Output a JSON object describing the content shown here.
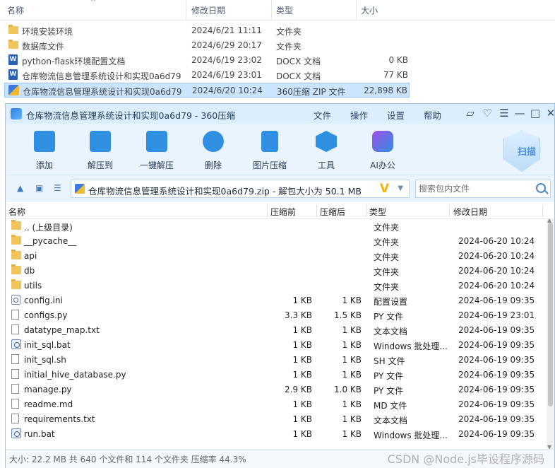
{
  "explorer": {
    "columns": {
      "name": "名称",
      "date": "修改日期",
      "type": "类型",
      "size": "大小"
    },
    "rows": [
      {
        "icon": "folder-icon",
        "name": "环境安装环境",
        "date": "2024/6/21 11:11",
        "type": "文件夹",
        "size": ""
      },
      {
        "icon": "folder-icon",
        "name": "数据库文件",
        "date": "2024/6/29 20:17",
        "type": "文件夹",
        "size": ""
      },
      {
        "icon": "word-doc-icon",
        "name": "python-flask环境配置文档",
        "date": "2024/6/19 23:02",
        "type": "DOCX 文档",
        "size": "0 KB"
      },
      {
        "icon": "word-doc-icon",
        "name": "仓库物流信息管理系统设计和实现0a6d79",
        "date": "2024/6/19 23:01",
        "type": "DOCX 文档",
        "size": "77 KB"
      },
      {
        "icon": "zip-archive-icon",
        "name": "仓库物流信息管理系统设计和实现0a6d79",
        "date": "2024/6/20 10:24",
        "type": "360压缩 ZIP 文件",
        "size": "22,898 KB",
        "selected": true
      }
    ]
  },
  "window": {
    "title": "仓库物流信息管理系统设计和实现0a6d79 - 360压缩",
    "menu": {
      "file": "文件",
      "ops": "操作",
      "settings": "设置",
      "help": "帮助"
    },
    "toolbar": {
      "add": "添加",
      "extract_to": "解压到",
      "one_click": "一键解压",
      "delete": "删除",
      "image_compress": "图片压缩",
      "tools": "工具",
      "ai_office": "AI办公",
      "scan": "扫描"
    },
    "address": "仓库物流信息管理系统设计和实现0a6d79.zip - 解包大小为 50.1 MB",
    "search_placeholder": "搜索包内文件",
    "list_columns": {
      "name": "名称",
      "compressed": "压缩前",
      "packed": "压缩后",
      "type": "类型",
      "date": "修改日期"
    },
    "files": [
      {
        "icon": "folder-icon",
        "name": ".. (上级目录)",
        "before": "",
        "after": "",
        "type": "文件夹",
        "date": ""
      },
      {
        "icon": "folder-icon",
        "name": "__pycache__",
        "before": "",
        "after": "",
        "type": "文件夹",
        "date": "2024-06-20 10:24"
      },
      {
        "icon": "folder-icon",
        "name": "api",
        "before": "",
        "after": "",
        "type": "文件夹",
        "date": "2024-06-20 10:24"
      },
      {
        "icon": "folder-icon",
        "name": "db",
        "before": "",
        "after": "",
        "type": "文件夹",
        "date": "2024-06-20 10:24"
      },
      {
        "icon": "folder-icon",
        "name": "utils",
        "before": "",
        "after": "",
        "type": "文件夹",
        "date": "2024-06-20 10:24"
      },
      {
        "icon": "config-file-icon",
        "name": "config.ini",
        "before": "1 KB",
        "after": "1 KB",
        "type": "配置设置",
        "date": "2024-06-19 09:35"
      },
      {
        "icon": "file-icon",
        "name": "configs.py",
        "before": "3.3 KB",
        "after": "1.5 KB",
        "type": "PY 文件",
        "date": "2024-06-19 23:01"
      },
      {
        "icon": "file-icon",
        "name": "datatype_map.txt",
        "before": "1 KB",
        "after": "1 KB",
        "type": "文本文档",
        "date": "2024-06-19 09:35"
      },
      {
        "icon": "batch-file-icon",
        "name": "init_sql.bat",
        "before": "1 KB",
        "after": "1 KB",
        "type": "Windows 批处理...",
        "date": "2024-06-19 09:35"
      },
      {
        "icon": "file-icon",
        "name": "init_sql.sh",
        "before": "1 KB",
        "after": "1 KB",
        "type": "SH 文件",
        "date": "2024-06-19 09:35"
      },
      {
        "icon": "file-icon",
        "name": "initial_hive_database.py",
        "before": "1 KB",
        "after": "1 KB",
        "type": "PY 文件",
        "date": "2024-06-19 09:35"
      },
      {
        "icon": "file-icon",
        "name": "manage.py",
        "before": "2.9 KB",
        "after": "1.0 KB",
        "type": "PY 文件",
        "date": "2024-06-19 09:35"
      },
      {
        "icon": "file-icon",
        "name": "readme.md",
        "before": "1 KB",
        "after": "1 KB",
        "type": "MD 文件",
        "date": "2024-06-19 09:35"
      },
      {
        "icon": "file-icon",
        "name": "requirements.txt",
        "before": "1 KB",
        "after": "1 KB",
        "type": "文本文档",
        "date": "2024-06-19 09:35"
      },
      {
        "icon": "batch-file-icon",
        "name": "run.bat",
        "before": "1 KB",
        "after": "1 KB",
        "type": "Windows 批处理...",
        "date": "2024-06-19 09:35"
      }
    ],
    "status": "大小: 22.2 MB 共 640 个文件和 114 个文件夹 压缩率 44.3%",
    "watermark": "CSDN @Node.js毕设程序源码"
  }
}
